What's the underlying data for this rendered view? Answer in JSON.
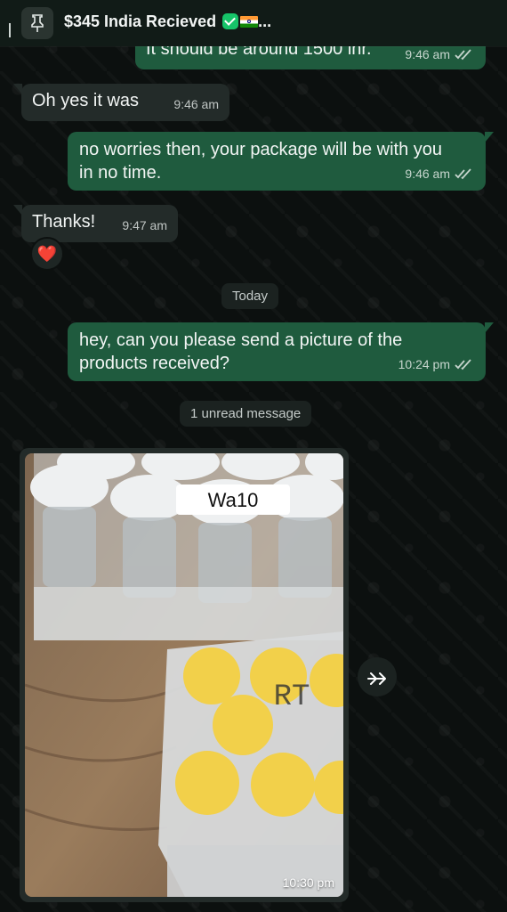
{
  "header": {
    "pinned_title": "$345 India Recieved",
    "ellipsis": "...",
    "icons": [
      "pin-icon",
      "verified-check-icon",
      "india-flag-icon"
    ]
  },
  "messages": [
    {
      "direction": "out",
      "text": "It should be around 1500 inr.",
      "time": "9:46 am",
      "status": "read"
    },
    {
      "direction": "in",
      "text": "Oh yes it was",
      "time": "9:46 am"
    },
    {
      "direction": "out",
      "text": "no worries then, your package will be with you in no time.",
      "time": "9:46 am",
      "status": "read"
    },
    {
      "direction": "in",
      "text": "Thanks!",
      "time": "9:47 am",
      "reaction": "❤️"
    },
    {
      "direction": "out",
      "text": "hey, can you please send a picture of the products received?",
      "time": "10:24 pm",
      "status": "read"
    },
    {
      "direction": "in",
      "type": "image",
      "time": "10:30 pm",
      "image_labels": [
        "Wa10",
        "RT"
      ]
    }
  ],
  "separators": {
    "date": "Today",
    "unread": "1 unread message"
  },
  "colors": {
    "outgoing_bubble": "#1f5b3e",
    "incoming_bubble": "#232b29",
    "read_ticks": "#c6d5cd",
    "background": "#0c100f"
  }
}
